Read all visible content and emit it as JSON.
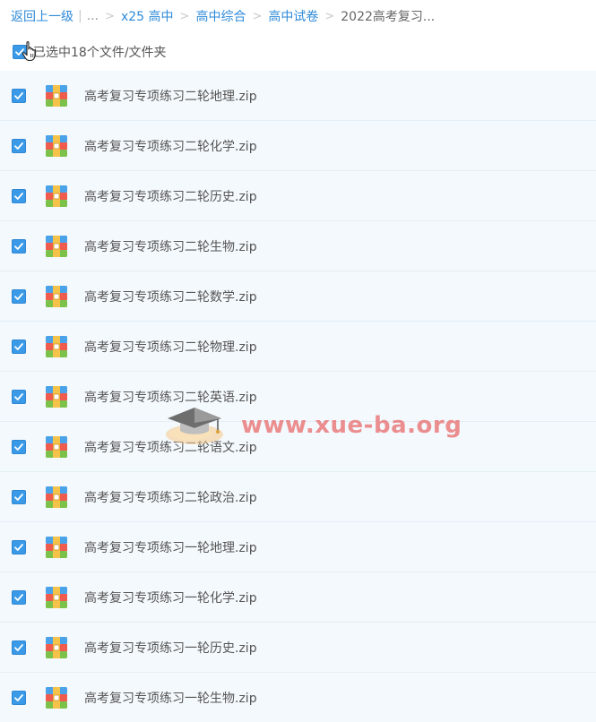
{
  "breadcrumb": {
    "back": "返回上一级",
    "pipe": "|",
    "ellipsis": "...",
    "separator": ">",
    "items": [
      "x25 高中",
      "高中综合",
      "高中试卷"
    ],
    "current": "2022高考复习..."
  },
  "selection": {
    "label": "已选中18个文件/文件夹"
  },
  "files": [
    "高考复习专项练习二轮地理.zip",
    "高考复习专项练习二轮化学.zip",
    "高考复习专项练习二轮历史.zip",
    "高考复习专项练习二轮生物.zip",
    "高考复习专项练习二轮数学.zip",
    "高考复习专项练习二轮物理.zip",
    "高考复习专项练习二轮英语.zip",
    "高考复习专项练习二轮语文.zip",
    "高考复习专项练习二轮政治.zip",
    "高考复习专项练习一轮地理.zip",
    "高考复习专项练习一轮化学.zip",
    "高考复习专项练习一轮历史.zip",
    "高考复习专项练习一轮生物.zip"
  ],
  "watermark": {
    "text": "www.xue-ba.org"
  },
  "colors": {
    "link": "#2e8ad8",
    "checkbox": "#3a9ae8",
    "row_bg": "#f4f9fd"
  }
}
